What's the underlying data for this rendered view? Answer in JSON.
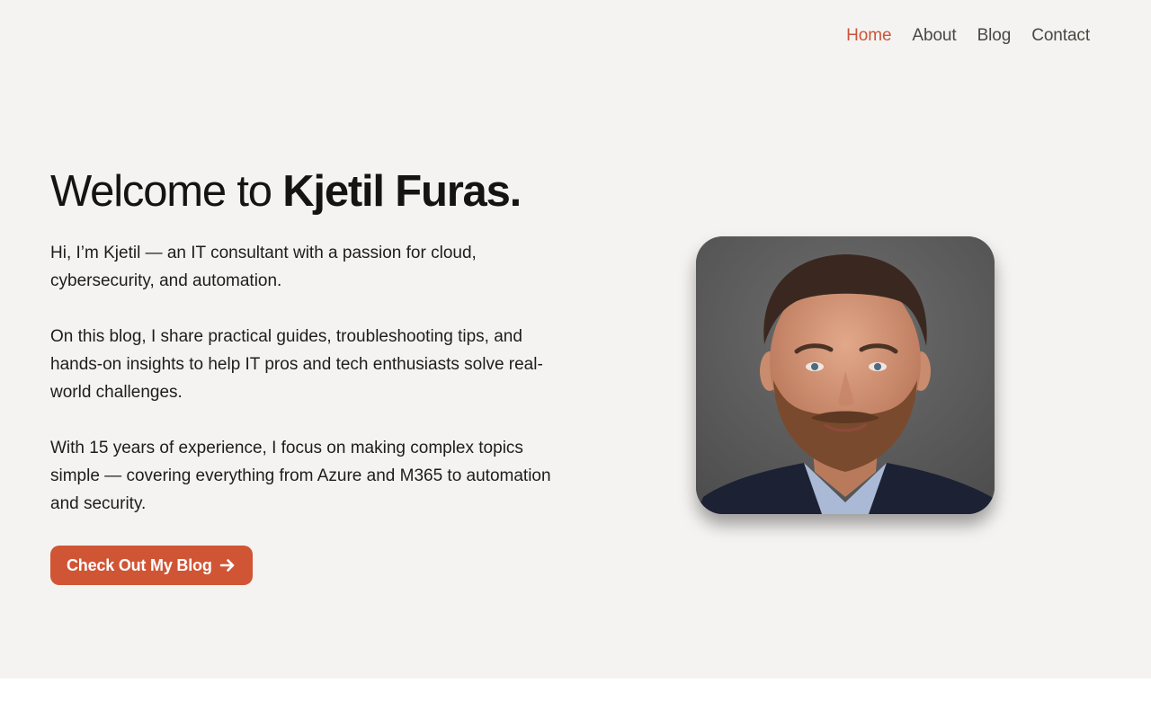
{
  "nav": {
    "items": [
      {
        "label": "Home",
        "active": true
      },
      {
        "label": "About",
        "active": false
      },
      {
        "label": "Blog",
        "active": false
      },
      {
        "label": "Contact",
        "active": false
      }
    ]
  },
  "hero": {
    "title_prefix": "Welcome to ",
    "title_name": "Kjetil Furas.",
    "paragraphs": [
      "Hi, I’m Kjetil — an IT consultant with a passion for cloud, cybersecurity, and automation.",
      "On this blog, I share practical guides, troubleshooting tips, and hands-on insights to help IT pros and tech enthusiasts solve real-world challenges.",
      "With 15 years of experience, I focus on making complex topics simple — covering everything from Azure and M365 to automation and security."
    ],
    "cta_label": "Check Out My Blog",
    "cta_icon": "arrow-right-icon",
    "photo_icon": "portrait-photo"
  },
  "colors": {
    "accent": "#d05535",
    "nav_active": "#c8553a",
    "hero_background": "#f5f3f1",
    "page_background": "#ffffff"
  }
}
